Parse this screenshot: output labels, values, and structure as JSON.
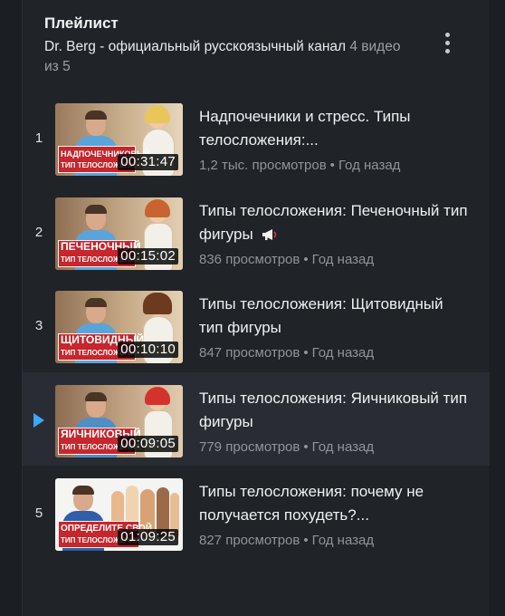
{
  "playlist": {
    "title": "Плейлист",
    "channel": "Dr. Berg - официальный русскоязычный канал",
    "count": "4 видео из 5",
    "menu_icon": "more-vert-icon"
  },
  "colors": {
    "accent": "#3ea6ff",
    "banner": "#c6262c"
  },
  "videos": [
    {
      "index": "1",
      "title": "Надпочечники и стресс. Типы телосложения:...",
      "views": "1,2 тыс. просмотров",
      "age": "Год назад",
      "duration": "00:31:47",
      "banner_line1": "НАДПОЧЕЧНИКОВЫЙ",
      "banner_line2": "ТИП ТЕЛОСЛОЖЕНИЯ",
      "active": false
    },
    {
      "index": "2",
      "title": "Типы телосложения: Печеночный тип фигуры",
      "views": "836 просмотров",
      "age": "Год назад",
      "duration": "00:15:02",
      "banner_line1": "ПЕЧЕНОЧНЫЙ",
      "banner_line2": "ТИП ТЕЛОСЛОЖЕНИЯ",
      "extra_icon": "megaphone-icon",
      "active": false
    },
    {
      "index": "3",
      "title": "Типы телосложения: Щитовидный тип фигуры",
      "views": "847 просмотров",
      "age": "Год назад",
      "duration": "00:10:10",
      "banner_line1": "ЩИТОВИДНЫЙ",
      "banner_line2": "ТИП ТЕЛОСЛОЖЕНИЯ",
      "active": false
    },
    {
      "index": "",
      "title": "Типы телосложения: Яичниковый тип фигуры",
      "views": "779 просмотров",
      "age": "Год назад",
      "duration": "00:09:05",
      "banner_line1": "ЯИЧНИКОВЫЙ",
      "banner_line2": "ТИП ТЕЛОСЛОЖЕНИЯ",
      "active": true,
      "active_icon": "now-playing-icon"
    },
    {
      "index": "5",
      "title": "Типы телосложения: почему не получается похудеть?...",
      "views": "827 просмотров",
      "age": "Год назад",
      "duration": "01:09:25",
      "banner_line1": "ОПРЕДЕЛИТЕ СВОЙ",
      "banner_line2": "ТИП ТЕЛОСЛОЖЕНИЯ",
      "active": false
    }
  ],
  "separator": "•"
}
